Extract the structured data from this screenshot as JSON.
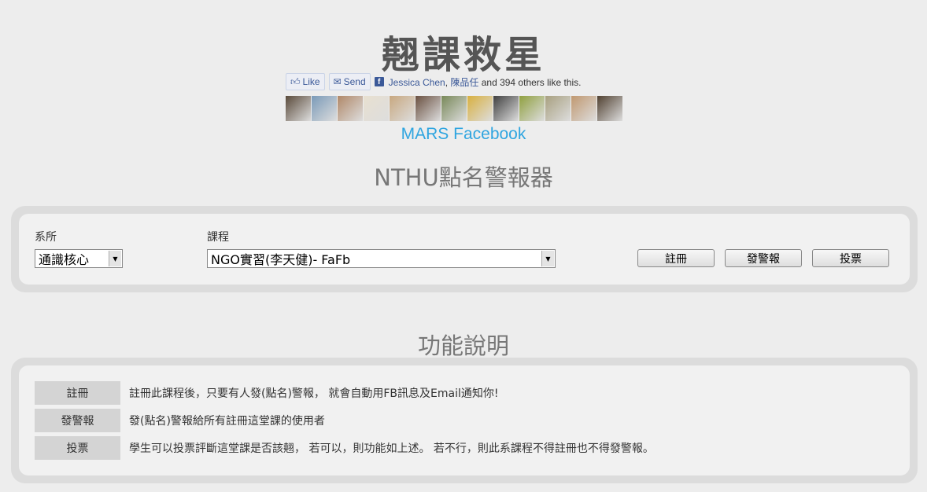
{
  "page_title": "翹課救星",
  "facebook": {
    "like_label": "Like",
    "send_label": "Send",
    "name1": "Jessica Chen",
    "separator": ", ",
    "name2": "陳品任",
    "suffix": " and 394 others like this.",
    "faces": [
      "#5a4a3a",
      "#7a9ab8",
      "#b08868",
      "#e8e0d0",
      "#c8a880",
      "#6a5040",
      "#788858",
      "#d8b040",
      "#404040",
      "#90a040",
      "#a8a080",
      "#c09870",
      "#504030"
    ]
  },
  "mars_link": "MARS Facebook",
  "section1_title": "NTHU點名警報器",
  "form": {
    "dept_label": "系所",
    "dept_value": "通識核心",
    "course_label": "課程",
    "course_value": "NGO實習(李天健)- FaFb",
    "btn_register": "註冊",
    "btn_alert": "發警報",
    "btn_vote": "投票"
  },
  "section2_title": "功能說明",
  "features": [
    {
      "tag": "註冊",
      "desc": "註冊此課程後，只要有人發(點名)警報， 就會自動用FB訊息及Email通知你!"
    },
    {
      "tag": "發警報",
      "desc": "發(點名)警報給所有註冊這堂課的使用者"
    },
    {
      "tag": "投票",
      "desc": "學生可以投票評斷這堂課是否該翹， 若可以，則功能如上述。 若不行，則此系課程不得註冊也不得發警報。"
    }
  ]
}
